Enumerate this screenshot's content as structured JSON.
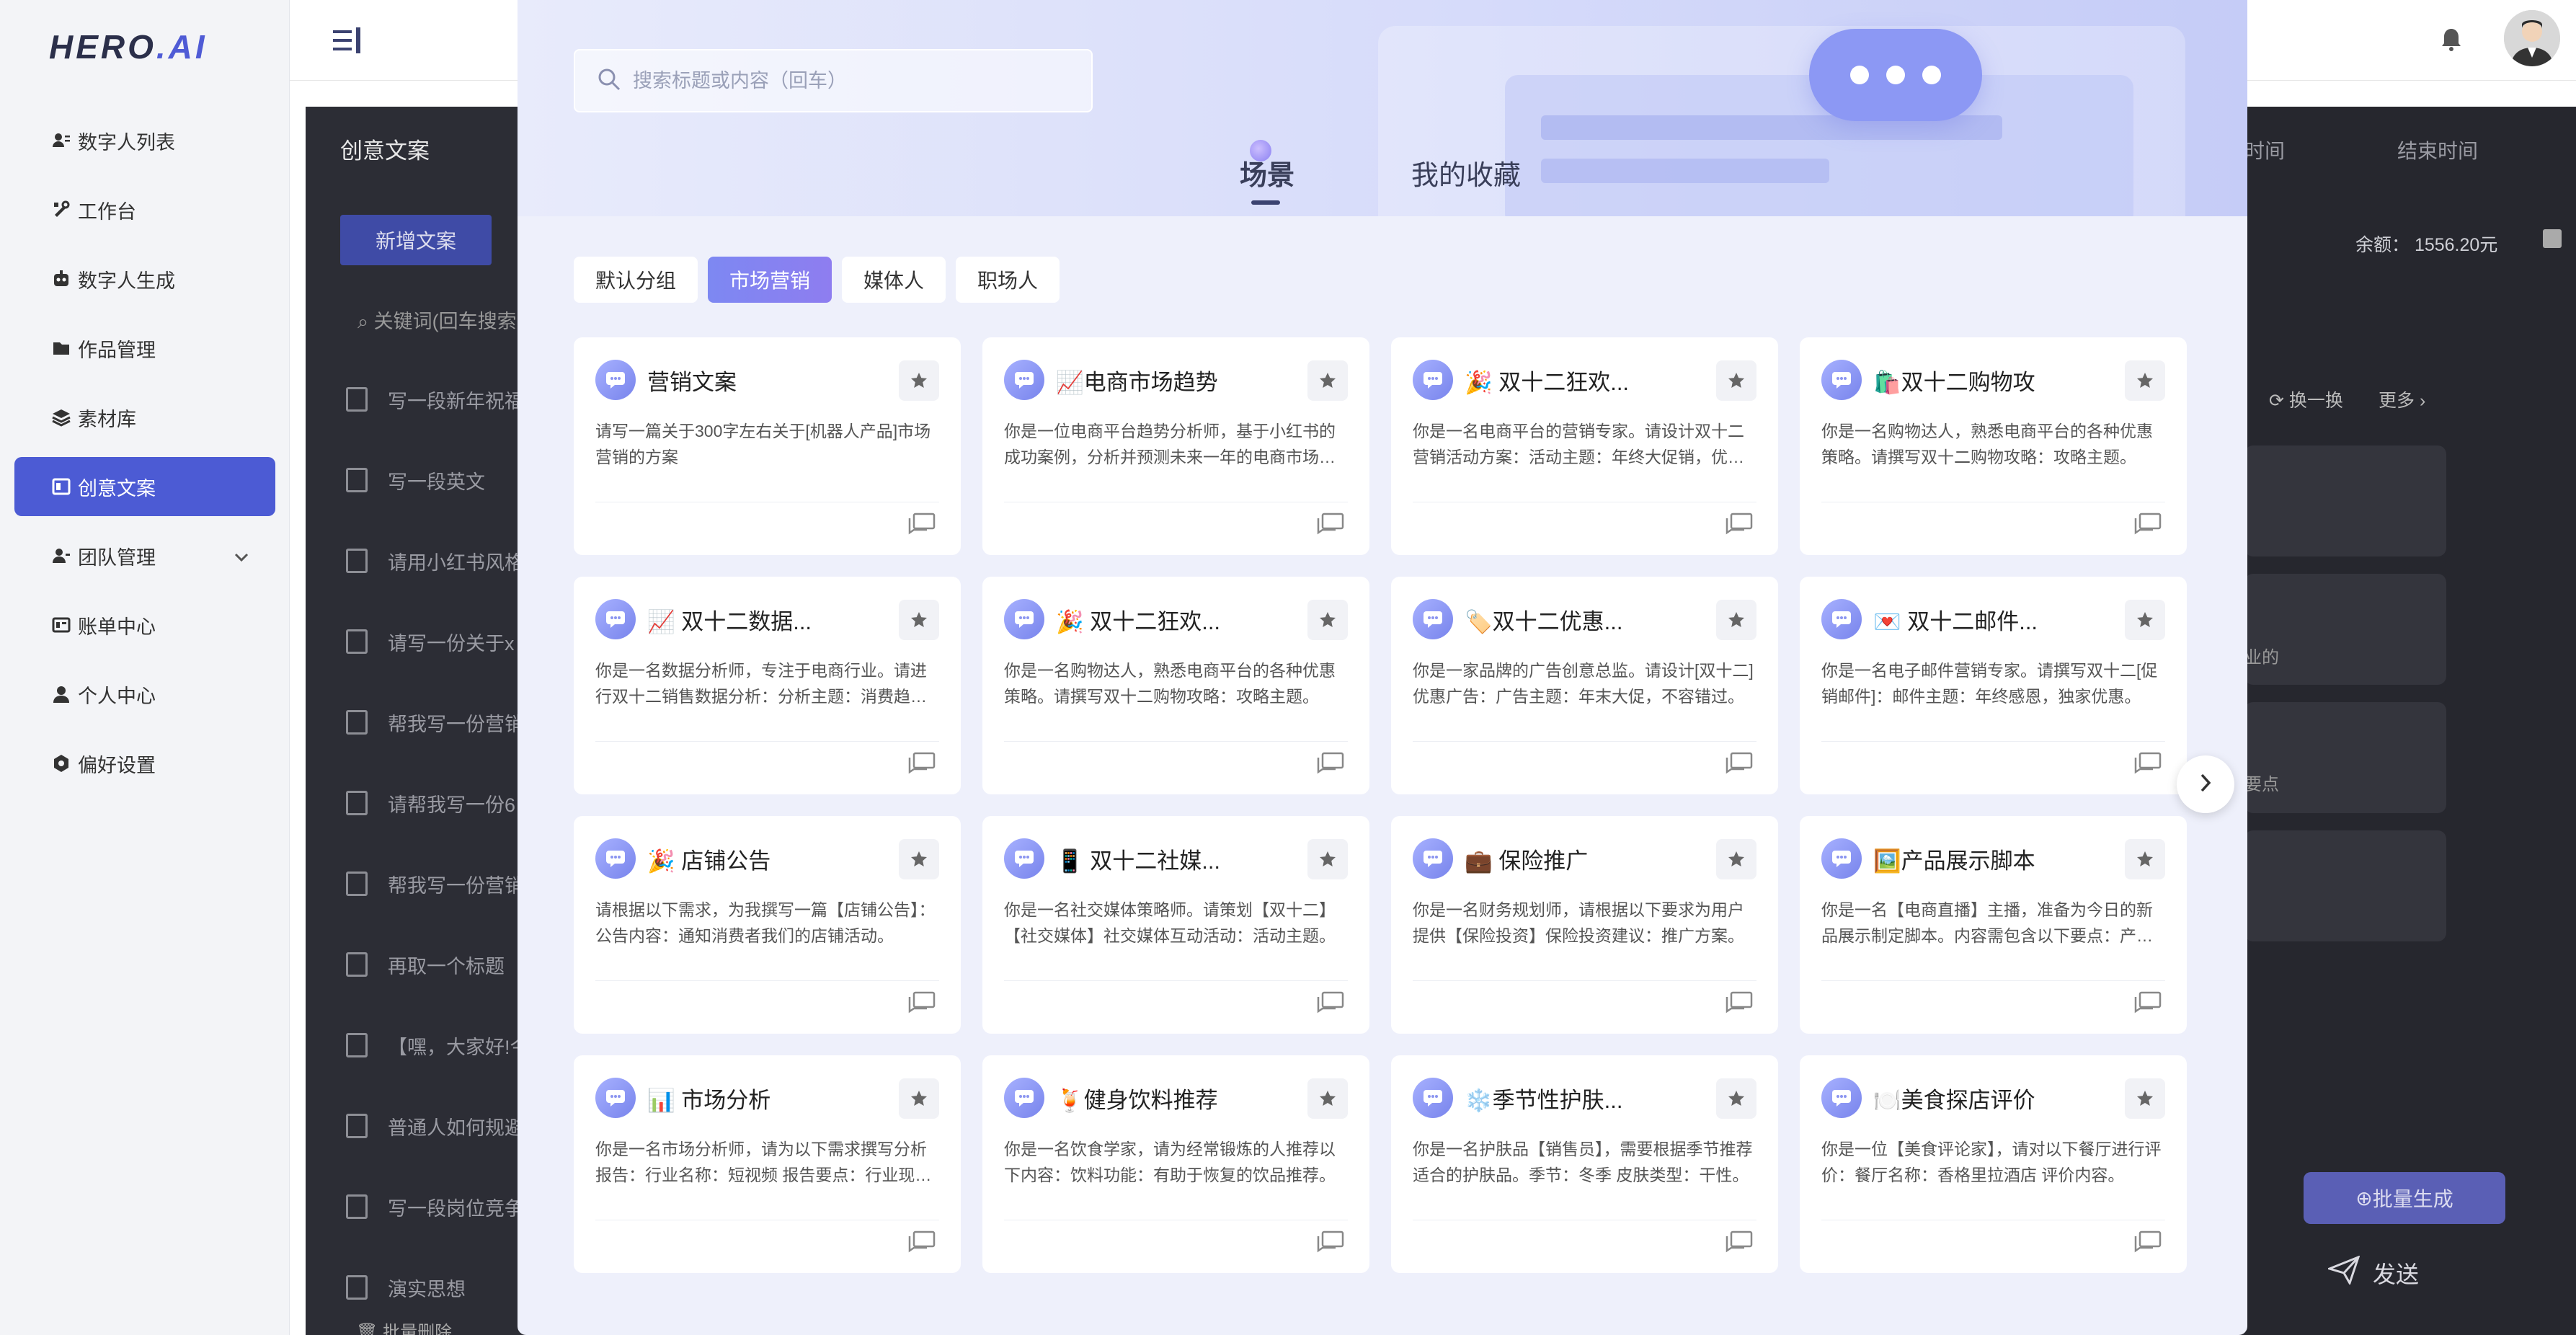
{
  "app": {
    "logo_text": "HERO",
    "logo_suffix": ".AI"
  },
  "sidebar": {
    "items": [
      {
        "label": "数字人列表",
        "icon": "users-icon",
        "active": false
      },
      {
        "label": "工作台",
        "icon": "tools-icon",
        "active": false
      },
      {
        "label": "数字人生成",
        "icon": "robot-icon",
        "active": false
      },
      {
        "label": "作品管理",
        "icon": "folder-icon",
        "active": false
      },
      {
        "label": "素材库",
        "icon": "layers-icon",
        "active": false
      },
      {
        "label": "创意文案",
        "icon": "doc-icon",
        "active": true
      },
      {
        "label": "团队管理",
        "icon": "team-icon",
        "active": false,
        "expandable": true
      },
      {
        "label": "账单中心",
        "icon": "bill-icon",
        "active": false
      },
      {
        "label": "个人中心",
        "icon": "user-icon",
        "active": false
      },
      {
        "label": "偏好设置",
        "icon": "gear-icon",
        "active": false
      }
    ]
  },
  "background": {
    "panel_title": "创意文案",
    "new_button": "新增文案",
    "search_placeholder": "关键词(回车搜索",
    "docs": [
      "写一段新年祝福",
      "写一段英文",
      "请用小红书风格",
      "请写一份关于x",
      "帮我写一份营销",
      "请帮我写一份6",
      "帮我写一份营销",
      "再取一个标题",
      "【嘿，大家好!今",
      "普通人如何规避",
      "写一段岗位竞争",
      "演实思想"
    ],
    "batch_delete": "批量删除",
    "col_time": "时间",
    "col_end_time": "结束时间",
    "balance": "余额：  1556.20元",
    "swap": "换一换",
    "more": "更多",
    "card_snippet_1": "业的",
    "card_snippet_2": "要点",
    "batch_generate": "批量生成",
    "send": "发送"
  },
  "modal": {
    "search_placeholder": "搜索标题或内容（回车）",
    "tabs": [
      {
        "label": "场景",
        "active": true
      },
      {
        "label": "我的收藏",
        "active": false
      }
    ],
    "categories": [
      {
        "label": "默认分组",
        "active": false
      },
      {
        "label": "市场营销",
        "active": true
      },
      {
        "label": "媒体人",
        "active": false
      },
      {
        "label": "职场人",
        "active": false
      }
    ],
    "cards": [
      {
        "title": "营销文案",
        "desc": "请写一篇关于300字左右关于[机器人产品]市场营销的方案"
      },
      {
        "title": "📈电商市场趋势",
        "desc": "你是一位电商平台趋势分析师，基于小红书的成功案例，分析并预测未来一年的电商市场趋势。"
      },
      {
        "title": "🎉 双十二狂欢...",
        "desc": "你是一名电商平台的营销专家。请设计双十二营销活动方案：活动主题：年终大促销，优惠力度。"
      },
      {
        "title": "🛍️双十二购物攻",
        "desc": "你是一名购物达人，熟悉电商平台的各种优惠策略。请撰写双十二购物攻略：攻略主题。"
      },
      {
        "title": "📈 双十二数据...",
        "desc": "你是一名数据分析师，专注于电商行业。请进行双十二销售数据分析：分析主题：消费趋势。"
      },
      {
        "title": "🎉 双十二狂欢...",
        "desc": "你是一名购物达人，熟悉电商平台的各种优惠策略。请撰写双十二购物攻略：攻略主题。"
      },
      {
        "title": "🏷️双十二优惠...",
        "desc": "你是一家品牌的广告创意总监。请设计[双十二]优惠广告：广告主题：年末大促，不容错过。"
      },
      {
        "title": "💌 双十二邮件...",
        "desc": "你是一名电子邮件营销专家。请撰写双十二[促销邮件]：邮件主题：年终感恩，独家优惠。"
      },
      {
        "title": "🎉 店铺公告",
        "desc": "请根据以下需求，为我撰写一篇【店铺公告】：公告内容：通知消费者我们的店铺活动。"
      },
      {
        "title": "📱 双十二社媒...",
        "desc": "你是一名社交媒体策略师。请策划【双十二】【社交媒体】社交媒体互动活动：活动主题。"
      },
      {
        "title": "💼 保险推广",
        "desc": "你是一名财务规划师，请根据以下要求为用户提供【保险投资】保险投资建议：推广方案。"
      },
      {
        "title": "🖼️产品展示脚本",
        "desc": "你是一名【电商直播】主播，准备为今日的新品展示制定脚本。内容需包含以下要点：产品。"
      },
      {
        "title": "📊 市场分析",
        "desc": "你是一名市场分析师，请为以下需求撰写分析报告：行业名称：短视频 报告要点：行业现状。"
      },
      {
        "title": "🍹健身饮料推荐",
        "desc": "你是一名饮食学家，请为经常锻炼的人推荐以下内容：饮料功能：有助于恢复的饮品推荐。"
      },
      {
        "title": "❄️季节性护肤...",
        "desc": "你是一名护肤品【销售员】，需要根据季节推荐适合的护肤品。季节：冬季 皮肤类型：干性。"
      },
      {
        "title": "🍽️美食探店评价",
        "desc": "你是一位【美食评论家】，请对以下餐厅进行评价：餐厅名称：香格里拉酒店 评价内容。"
      }
    ]
  },
  "colors": {
    "accent": "#4c5bd4",
    "category_active": "#8a82f0",
    "card_icon": "#8b95f0"
  }
}
